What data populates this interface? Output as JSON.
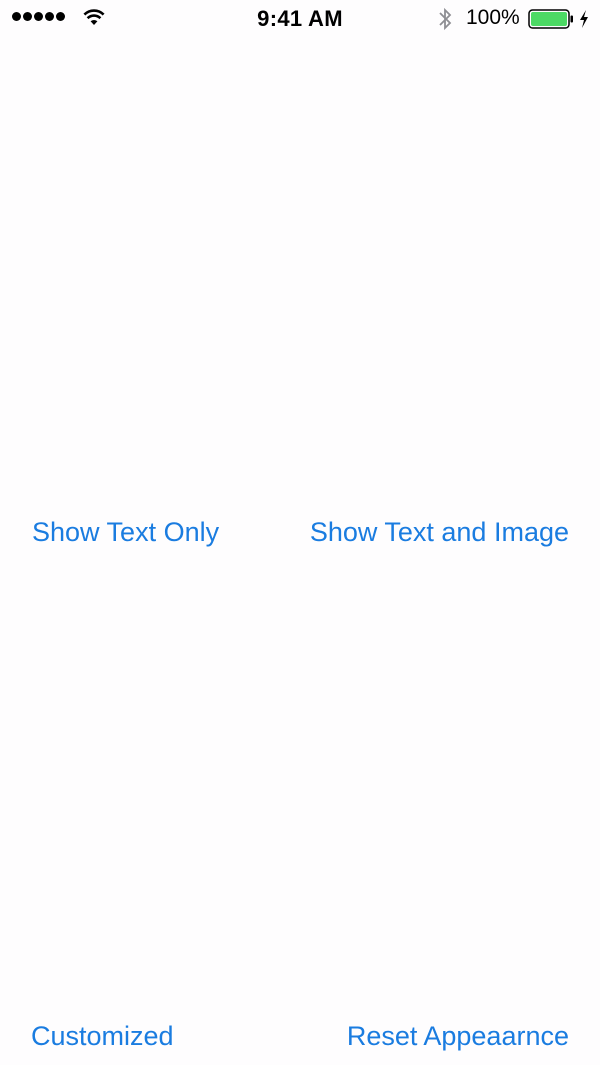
{
  "status_bar": {
    "time": "9:41 AM",
    "battery_percent": "100%",
    "signal_bars": 5,
    "battery_level": 1.0,
    "icons": [
      "signal-dots",
      "wifi-icon",
      "bluetooth-icon",
      "battery-icon",
      "charging-bolt-icon"
    ]
  },
  "buttons": {
    "show_text_only": "Show Text Only",
    "show_text_and_image": "Show Text and Image",
    "customized": "Customized",
    "reset_appearance": "Reset Appeaarnce"
  },
  "colors": {
    "accent": "#1a7ce0",
    "background": "#fefdfe",
    "battery_fill": "#4cd964"
  }
}
